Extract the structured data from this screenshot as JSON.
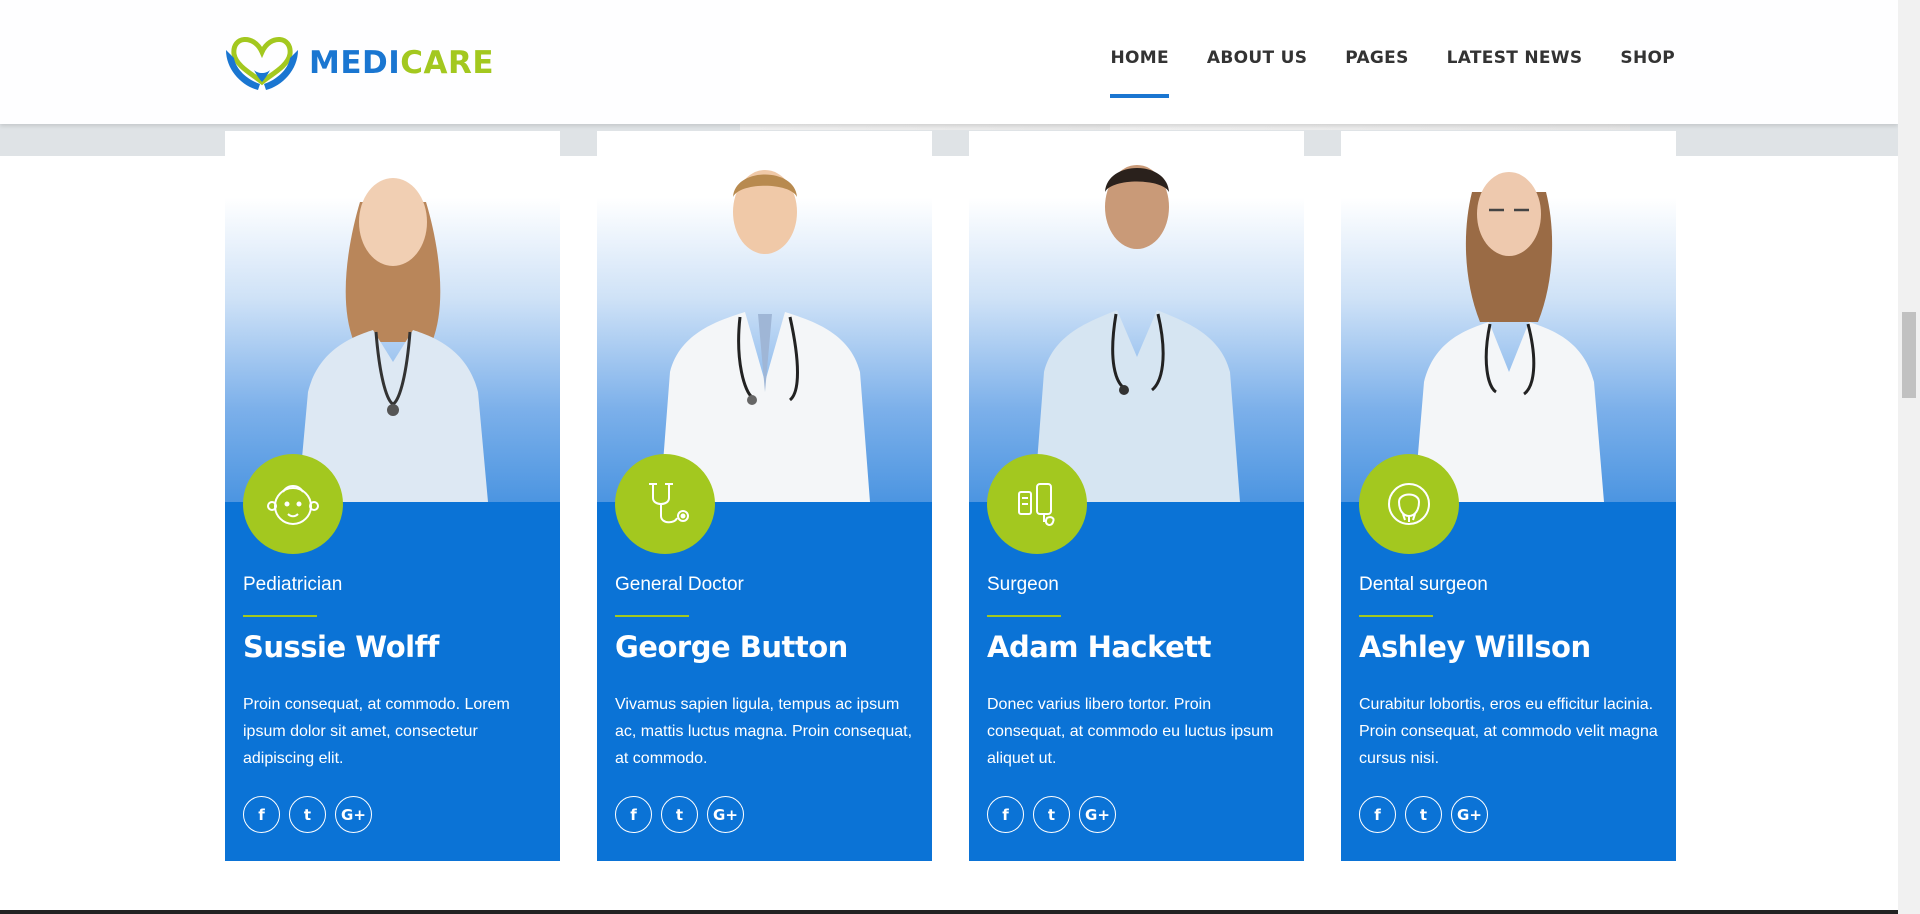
{
  "brand": {
    "name_part1": "MEDI",
    "name_part2": "CARE"
  },
  "nav": [
    {
      "label": "HOME",
      "active": true
    },
    {
      "label": "ABOUT US",
      "active": false
    },
    {
      "label": "PAGES",
      "active": false
    },
    {
      "label": "LATEST NEWS",
      "active": false
    },
    {
      "label": "SHOP",
      "active": false
    }
  ],
  "colors": {
    "primary": "#0b73d6",
    "accent": "#a3c81f",
    "nav_text": "#333333"
  },
  "doctors": [
    {
      "role": "Pediatrician",
      "name": "Sussie Wolff",
      "bio": "Proin consequat, at commodo. Lorem ipsum dolor sit amet, consectetur adipiscing elit.",
      "icon": "baby-face-icon",
      "socials": [
        "f",
        "t",
        "G+"
      ]
    },
    {
      "role": "General Doctor",
      "name": "George Button",
      "bio": "Vivamus sapien ligula, tempus ac ipsum ac, mattis luctus magna.  Proin consequat, at commodo.",
      "icon": "stethoscope-icon",
      "socials": [
        "f",
        "t",
        "G+"
      ]
    },
    {
      "role": "Surgeon",
      "name": "Adam Hackett",
      "bio": "Donec varius libero tortor. Proin consequat, at commodo eu luctus ipsum aliquet ut.",
      "icon": "iv-drip-icon",
      "socials": [
        "f",
        "t",
        "G+"
      ]
    },
    {
      "role": "Dental surgeon",
      "name": "Ashley Willson",
      "bio": "Curabitur lobortis, eros eu efficitur lacinia. Proin consequat, at commodo velit magna cursus nisi.",
      "icon": "dental-icon",
      "socials": [
        "f",
        "t",
        "G+"
      ]
    }
  ]
}
